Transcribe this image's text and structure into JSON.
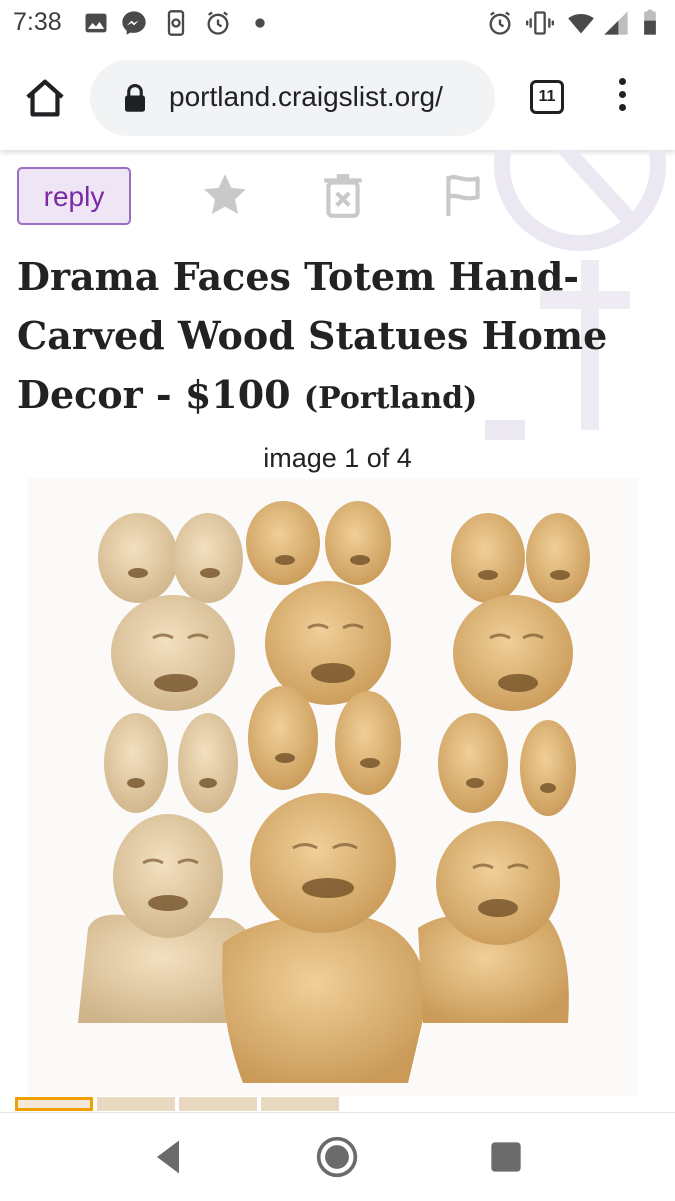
{
  "status_bar": {
    "time": "7:38",
    "left_icons": [
      "gallery-icon",
      "messenger-icon",
      "phone-sync-icon",
      "alarm-icon",
      "dot-icon"
    ],
    "right_icons": [
      "alarm-icon",
      "vibrate-icon",
      "wifi-icon",
      "signal-icon",
      "battery-icon"
    ]
  },
  "browser": {
    "url": "portland.craigslist.org/",
    "tab_count": "11",
    "icons": [
      "home-icon",
      "lock-icon",
      "tabs-icon",
      "overflow-menu-icon"
    ]
  },
  "post": {
    "reply_label": "reply",
    "action_icons": [
      "star-icon",
      "hide-icon",
      "flag-icon"
    ],
    "title": "Drama Faces Totem Hand-Carved Wood Statues Home Decor - $100",
    "location": "(Portland)",
    "image_counter": "image 1 of 4",
    "image_alt": "Three carved wooden totems of stacked expressive faces"
  },
  "nav": {
    "icons": [
      "back-icon",
      "home-circle-icon",
      "recents-icon"
    ]
  },
  "colors": {
    "reply_border": "#9b6fbf",
    "reply_bg": "#eee6f4",
    "reply_text": "#7a2aa5",
    "thumb_active": "#f0a000",
    "wood": "#d9ad6a"
  }
}
